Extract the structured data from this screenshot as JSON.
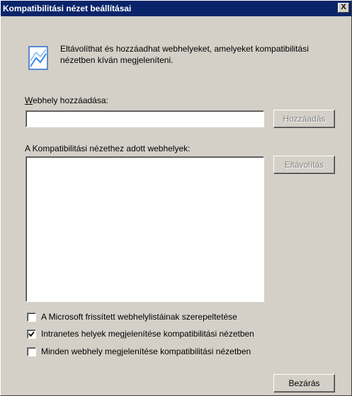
{
  "window": {
    "title": "Kompatibilitási nézet beállításai",
    "close_label": "X"
  },
  "info": {
    "icon": "compat-view-icon",
    "text": "Eltávolíthat és hozzáadhat webhelyeket, amelyeket kompatibilitási nézetben kíván megjeleníteni."
  },
  "add_site": {
    "label": "Webhely hozzáadása:",
    "value": "",
    "button": "Hozzáadás"
  },
  "site_list": {
    "label": "A Kompatibilitási nézethez adott webhelyek:",
    "items": [],
    "remove_button": "Eltávolítás"
  },
  "options": [
    {
      "label": "A Microsoft frissített webhelylistáinak szerepeltetése",
      "checked": false
    },
    {
      "label": "Intranetes helyek megjelenítése kompatibilitási nézetben",
      "checked": true
    },
    {
      "label": "Minden webhely megjelenítése kompatibilitási nézetben",
      "checked": false
    }
  ],
  "close_button": "Bezárás",
  "colors": {
    "titlebar": "#0a246a",
    "face": "#d4d0c8"
  }
}
